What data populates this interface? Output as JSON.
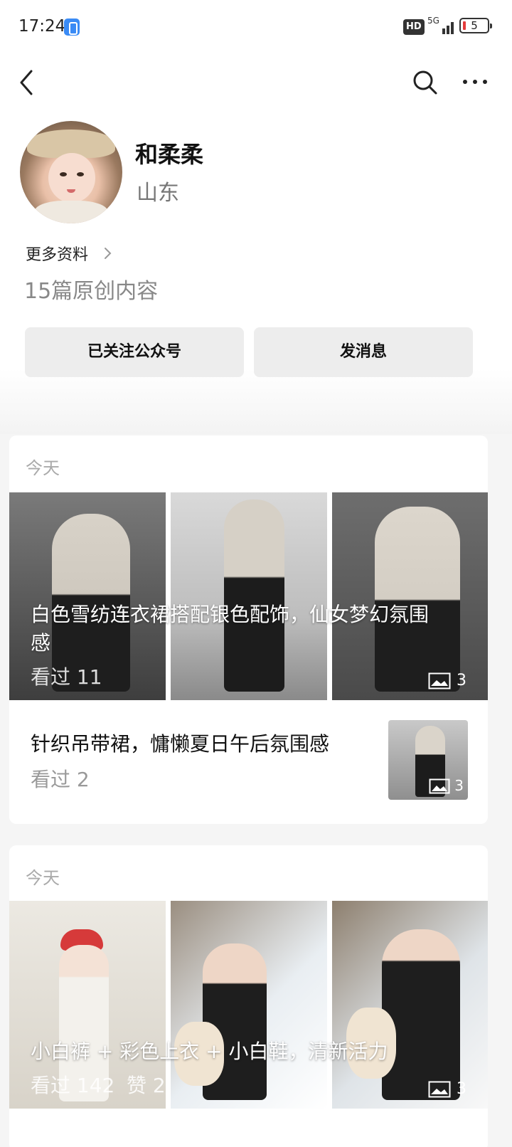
{
  "status_bar": {
    "time": "17:24",
    "hd": "HD",
    "network": "5G",
    "battery": "5"
  },
  "nav": {
    "back_icon": "chevron-left-icon",
    "search_icon": "search-icon",
    "more_icon": "more-dots-icon"
  },
  "profile": {
    "name": "和柔柔",
    "region": "山东",
    "more_info": "更多资料",
    "original_count": "15篇原创内容",
    "follow_button": "已关注公众号",
    "message_button": "发消息"
  },
  "feed": [
    {
      "day": "今天",
      "hero": {
        "title": "白色雪纺连衣裙搭配银色配饰，仙女梦幻氛围感",
        "views": "看过 11",
        "photo_count": "3"
      },
      "article": {
        "title": "针织吊带裙，慵懒夏日午后氛围感",
        "views": "看过 2",
        "photo_count": "3"
      }
    },
    {
      "day": "今天",
      "hero": {
        "title": "小白裤 + 彩色上衣 + 小白鞋，清新活力",
        "views": "看过 142",
        "likes": "赞 2",
        "photo_count": "3"
      }
    }
  ],
  "colors": {
    "background": "#f5f5f5",
    "button_bg": "#ededed",
    "card_bg": "#ffffff",
    "muted_text": "#999999"
  }
}
